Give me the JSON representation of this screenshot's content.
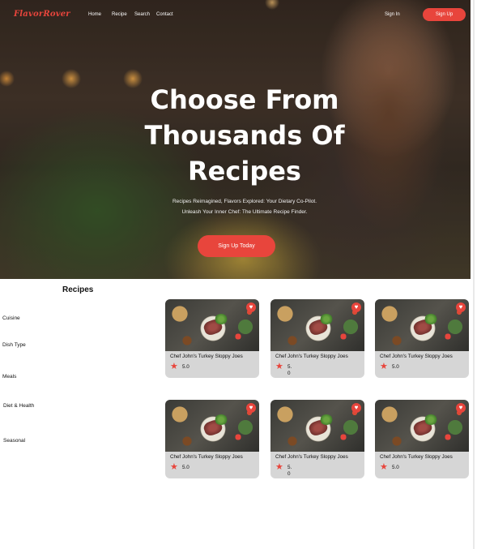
{
  "brand": {
    "logo": "FlavorRover",
    "accent": "#e8453c"
  },
  "nav": {
    "home": "Home",
    "recipe": "Recipe",
    "search": "Search",
    "contact": "Contact"
  },
  "auth": {
    "signin": "Sign In",
    "signup": "Sign Up"
  },
  "hero": {
    "title_line1": "Choose From",
    "title_line2": "Thousands Of",
    "title_line3": "Recipes",
    "subtitle_line1": "Recipes Reimagined, Flavors Explored: Your Dietary Co-Pilot.",
    "subtitle_line2": "Unleash Your Inner Chef: The Ultimate Recipe Finder.",
    "cta": "Sign Up Today"
  },
  "sidebar": {
    "heading": "Recipes",
    "filters": [
      "Cuisine",
      "Dish Type",
      "Meals",
      "Diet & Health",
      "Seasonal"
    ]
  },
  "recipes": [
    {
      "title": "Chef John's Turkey Sloppy Joes",
      "rating": "5.0"
    },
    {
      "title": "Chef John's Turkey Sloppy Joes",
      "rating": "5.0"
    },
    {
      "title": "Chef John's Turkey Sloppy Joes",
      "rating": "5.0"
    },
    {
      "title": "Chef John's Turkey Sloppy Joes",
      "rating": "5.0"
    },
    {
      "title": "Chef John's Turkey Sloppy Joes",
      "rating": "5.0"
    },
    {
      "title": "Chef John's Turkey Sloppy Joes",
      "rating": "5.0"
    }
  ],
  "icons": {
    "favorite": "heart-icon",
    "rating": "star-icon"
  }
}
